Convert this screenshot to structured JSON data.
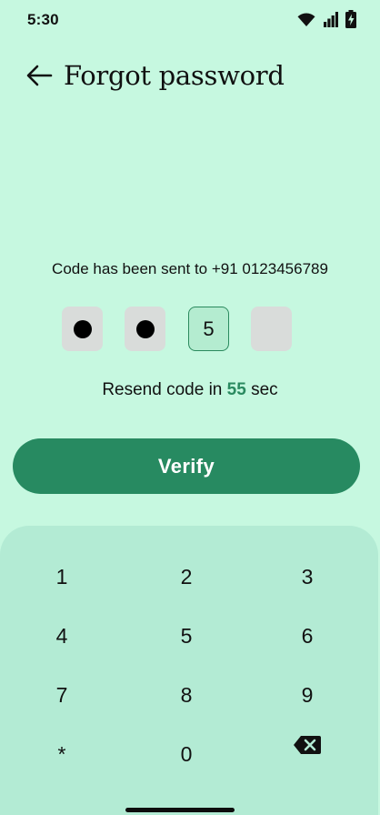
{
  "status_bar": {
    "time": "5:30",
    "icons": [
      "wifi-icon",
      "signal-icon",
      "battery-charging-icon"
    ]
  },
  "header": {
    "back_icon": "arrow-left-icon",
    "title": "Forgot password"
  },
  "otp": {
    "sent_message": "Code has been sent to +91 0123456789",
    "boxes": [
      {
        "state": "filled-masked",
        "value": ""
      },
      {
        "state": "filled-masked",
        "value": ""
      },
      {
        "state": "active",
        "value": "5"
      },
      {
        "state": "empty",
        "value": ""
      }
    ],
    "resend_prefix": "Resend code in ",
    "resend_seconds": "55",
    "resend_suffix": " sec"
  },
  "verify_button": {
    "label": "Verify"
  },
  "keypad": {
    "keys": [
      "1",
      "2",
      "3",
      "4",
      "5",
      "6",
      "7",
      "8",
      "9",
      "*",
      "0"
    ],
    "backspace_icon": "backspace-icon"
  },
  "colors": {
    "background": "#c6f8e0",
    "keypad_background": "#b3ebd4",
    "accent": "#278a61",
    "box_empty": "#d9dcda"
  }
}
